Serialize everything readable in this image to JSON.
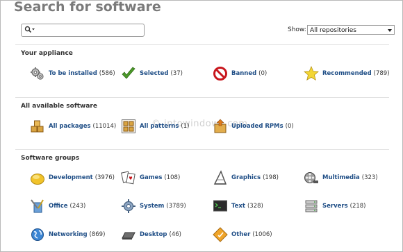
{
  "page_title": "Search for software",
  "search": {
    "placeholder": ""
  },
  "show": {
    "label": "Show:",
    "selected": "All repositories"
  },
  "watermark": "© intowindows.com",
  "sections": {
    "appliance": {
      "heading": "Your appliance",
      "items": [
        {
          "label": "To be installed",
          "count": "(586)",
          "icon": "gears-icon"
        },
        {
          "label": "Selected",
          "count": "(37)",
          "icon": "checkmark-icon"
        },
        {
          "label": "Banned",
          "count": "(0)",
          "icon": "banned-icon"
        },
        {
          "label": "Recommended",
          "count": "(789)",
          "icon": "star-icon"
        }
      ]
    },
    "available": {
      "heading": "All available software",
      "items": [
        {
          "label": "All packages",
          "count": "(11014)",
          "icon": "packages-icon"
        },
        {
          "label": "All patterns",
          "count": "(1)",
          "icon": "patterns-icon"
        },
        {
          "label": "Uploaded RPMs",
          "count": "(0)",
          "icon": "upload-box-icon"
        }
      ]
    },
    "groups": {
      "heading": "Software groups",
      "items": [
        {
          "label": "Development",
          "count": "(3976)",
          "icon": "development-icon"
        },
        {
          "label": "Games",
          "count": "(108)",
          "icon": "cards-icon"
        },
        {
          "label": "Graphics",
          "count": "(198)",
          "icon": "graphics-icon"
        },
        {
          "label": "Multimedia",
          "count": "(323)",
          "icon": "film-reel-icon"
        },
        {
          "label": "Office",
          "count": "(243)",
          "icon": "office-icon"
        },
        {
          "label": "System",
          "count": "(3789)",
          "icon": "system-gear-icon"
        },
        {
          "label": "Text",
          "count": "(328)",
          "icon": "terminal-icon"
        },
        {
          "label": "Servers",
          "count": "(218)",
          "icon": "server-icon"
        },
        {
          "label": "Networking",
          "count": "(869)",
          "icon": "globe-icon"
        },
        {
          "label": "Desktop",
          "count": "(46)",
          "icon": "desktop-icon"
        },
        {
          "label": "Other",
          "count": "(1006)",
          "icon": "other-icon"
        }
      ]
    }
  }
}
